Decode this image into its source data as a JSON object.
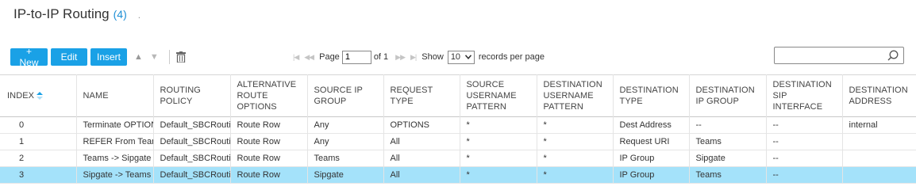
{
  "header": {
    "title": "IP-to-IP Routing",
    "count": "(4)",
    "dot": "."
  },
  "toolbar": {
    "new_label": "+ New",
    "edit_label": "Edit",
    "insert_label": "Insert",
    "move_up": "▲",
    "move_down": "▼"
  },
  "pager": {
    "first": "|◀",
    "prev": "◀◀",
    "page_label": "Page",
    "page_value": "1",
    "of_label": "of 1",
    "next": "▶▶",
    "last": "▶|",
    "show_label": "Show",
    "show_value": "10",
    "records_label": "records per page"
  },
  "search": {
    "placeholder": ""
  },
  "table": {
    "columns": [
      [
        "INDEX"
      ],
      [
        "NAME"
      ],
      [
        "ROUTING",
        "POLICY"
      ],
      [
        "ALTERNATIVE",
        "ROUTE",
        "OPTIONS"
      ],
      [
        "SOURCE IP",
        "GROUP"
      ],
      [
        "REQUEST TYPE"
      ],
      [
        "SOURCE",
        "USERNAME",
        "PATTERN"
      ],
      [
        "DESTINATION",
        "USERNAME",
        "PATTERN"
      ],
      [
        "DESTINATION",
        "TYPE"
      ],
      [
        "DESTINATION",
        "IP GROUP"
      ],
      [
        "DESTINATION",
        "SIP INTERFACE"
      ],
      [
        "DESTINATION",
        "ADDRESS"
      ]
    ],
    "rows": [
      [
        "0",
        "Terminate OPTIONS",
        "Default_SBCRoutingPolicy",
        "Route Row",
        "Any",
        "OPTIONS",
        "*",
        "*",
        "Dest Address",
        "--",
        "--",
        "internal"
      ],
      [
        "1",
        "REFER From Teams",
        "Default_SBCRoutingPolicy",
        "Route Row",
        "Any",
        "All",
        "*",
        "*",
        "Request URI",
        "Teams",
        "--",
        ""
      ],
      [
        "2",
        "Teams -> Sipgate",
        "Default_SBCRoutingPolicy",
        "Route Row",
        "Teams",
        "All",
        "*",
        "*",
        "IP Group",
        "Sipgate",
        "--",
        ""
      ],
      [
        "3",
        "Sipgate -> Teams",
        "Default_SBCRoutingPolicy",
        "Route Row",
        "Sipgate",
        "All",
        "*",
        "*",
        "IP Group",
        "Teams",
        "--",
        ""
      ]
    ],
    "selected_row": 3
  },
  "colors": {
    "accent": "#1aa1e6",
    "selected_row": "#a4e2fa",
    "count": "#1e8fd5"
  }
}
